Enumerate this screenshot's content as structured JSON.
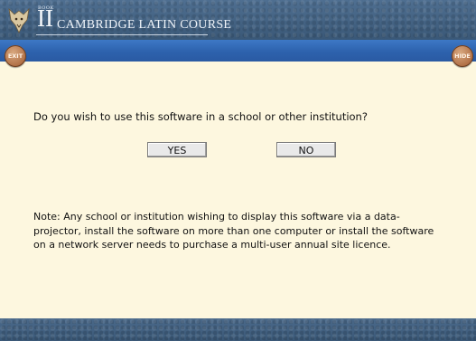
{
  "header": {
    "book_label": "BOOK",
    "book_number": "II",
    "title": "CAMBRIDGE LATIN COURSE",
    "logo_icon": "wolf-head-emblem-icon"
  },
  "toolbar": {
    "exit_label": "EXIT",
    "hide_label": "HIDE"
  },
  "dialog": {
    "question": "Do you wish to use this software in a school or other institution?",
    "yes_label": "YES",
    "no_label": "NO",
    "note": "Note: Any school or institution wishing to display this software via a data-projector, install the software on more than one computer or install the software on a network server needs to purchase a multi-user annual site licence."
  },
  "colors": {
    "header": "#3f6083",
    "band": "#2f66b2",
    "content_bg": "#fdf7df",
    "round_button": "#b06f45"
  }
}
